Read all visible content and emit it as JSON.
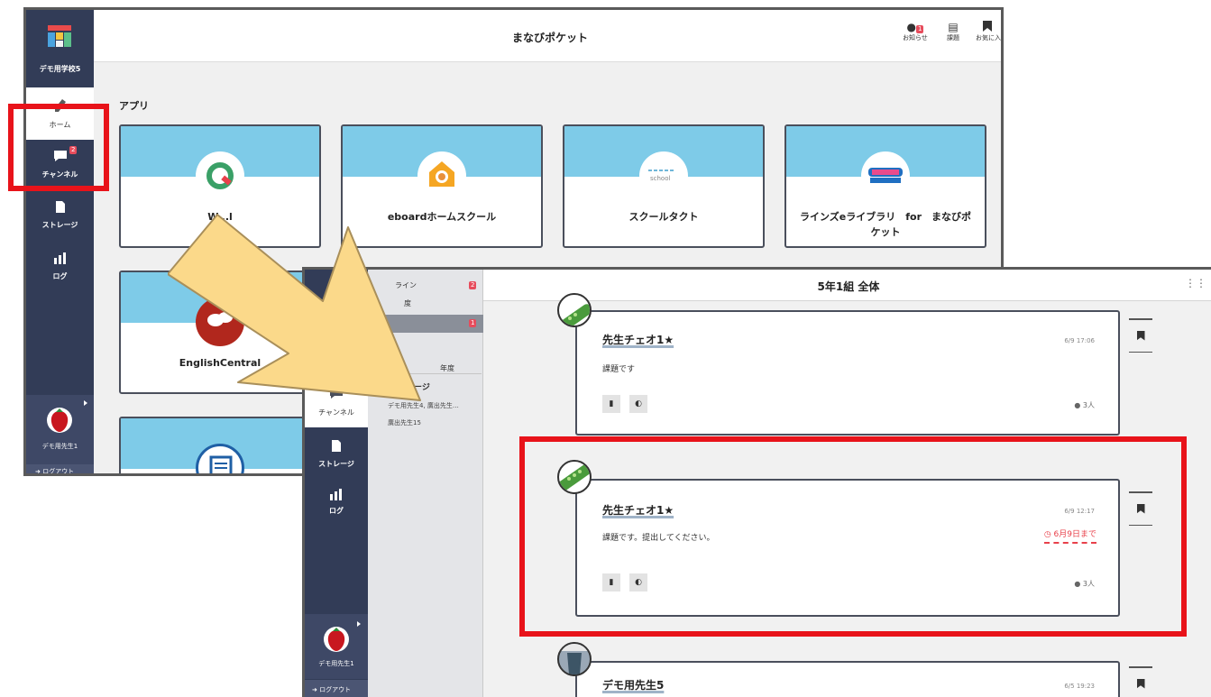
{
  "back_window": {
    "school_name": "デモ用学校5",
    "app_title": "まなびポケット",
    "top_icons": [
      {
        "icon": "bell-icon",
        "label": "お知らせ",
        "badge": "1"
      },
      {
        "icon": "assignment-icon",
        "label": "課題"
      },
      {
        "icon": "bookmark-icon",
        "label": "お気に入"
      }
    ],
    "nav": [
      {
        "icon": "pencil-icon",
        "label": "ホーム"
      },
      {
        "icon": "chat-icon",
        "label": "チャンネル",
        "badge": "2"
      },
      {
        "icon": "document-icon",
        "label": "ストレージ"
      },
      {
        "icon": "bar-chart-icon",
        "label": "ログ"
      }
    ],
    "apps_heading": "アプリ",
    "apps": [
      "W...l",
      "eboardホームスクール",
      "スクールタクト",
      "ラインズeライブラリ　for　まなびポケット",
      "EnglishCentral",
      ""
    ],
    "user_name": "デモ用先生1",
    "logout_label": "ログアウト"
  },
  "front_window": {
    "nav": [
      {
        "icon": "chat-icon",
        "label": "チャンネル",
        "badge": "2"
      },
      {
        "icon": "document-icon",
        "label": "ストレージ"
      },
      {
        "icon": "bar-chart-icon",
        "label": "ログ"
      }
    ],
    "panel": {
      "top_item": "ライン",
      "top_badge": "2",
      "top_sub": "度",
      "selected_badge": "1",
      "year_item": "年度",
      "section_label": "個別メッセージ",
      "messages": [
        "デモ用先生4, 廣出先生…",
        "廣出先生15"
      ]
    },
    "channel_title": "5年1組 全体",
    "posts": [
      {
        "author": "先生チェオ1★",
        "date": "6/9 17:06",
        "body": "課題です",
        "reads": "3人",
        "deadline": ""
      },
      {
        "author": "先生チェオ1★",
        "date": "6/9 12:17",
        "body": "課題です。提出してください。",
        "reads": "3人",
        "deadline": "6月9日まで"
      },
      {
        "author": "デモ用先生5",
        "date": "6/5 19:23",
        "body": "",
        "reads": "",
        "deadline": ""
      }
    ],
    "user_name": "デモ用先生1",
    "logout_label": "ログアウト"
  },
  "colors": {
    "sidebar": "#323c57",
    "card_band": "#7ecbe8",
    "highlight": "#e8131a",
    "arrow_fill": "#fbd98a",
    "badge": "#e74c5c",
    "deadline": "#e8404a"
  }
}
